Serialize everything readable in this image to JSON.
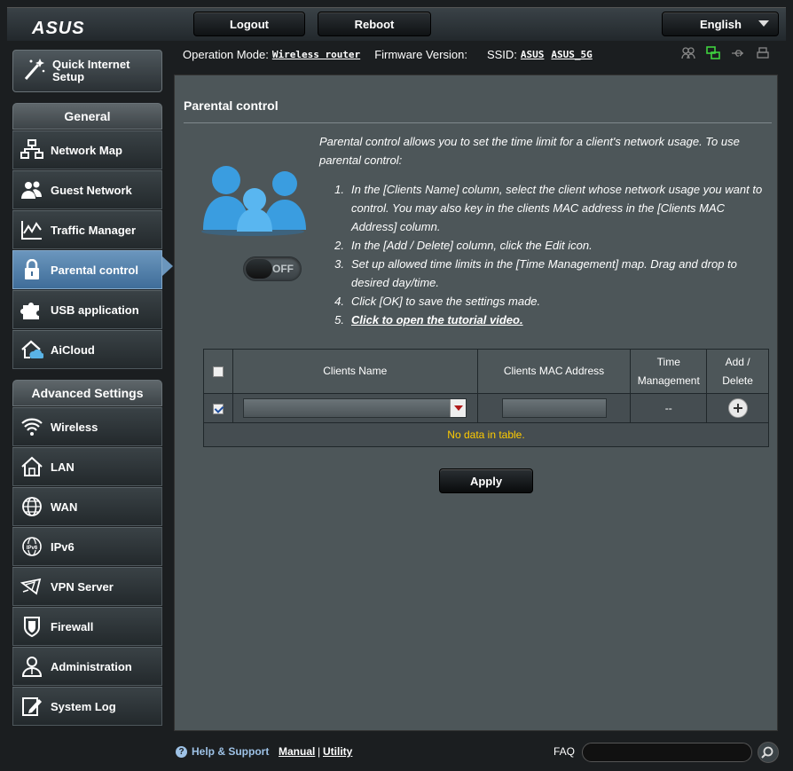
{
  "header": {
    "logo": "ASUS",
    "logout_label": "Logout",
    "reboot_label": "Reboot",
    "language": "English"
  },
  "infobar": {
    "operation_mode_label": "Operation Mode:",
    "operation_mode_value": "Wireless router",
    "firmware_label": "Firmware Version:",
    "ssid_label": "SSID:",
    "ssid_1": "ASUS",
    "ssid_2": "ASUS_5G",
    "status_icons": [
      "clients-icon",
      "network-icon",
      "usb-icon",
      "printer-icon"
    ]
  },
  "sidebar": {
    "qis_label_line1": "Quick Internet",
    "qis_label_line2": "Setup",
    "general_heading": "General",
    "general_items": [
      {
        "label": "Network Map",
        "icon": "network-map-icon"
      },
      {
        "label": "Guest Network",
        "icon": "guest-network-icon"
      },
      {
        "label": "Traffic Manager",
        "icon": "traffic-manager-icon"
      },
      {
        "label": "Parental control",
        "icon": "parental-control-icon",
        "active": true
      },
      {
        "label": "USB application",
        "icon": "usb-application-icon"
      },
      {
        "label": "AiCloud",
        "icon": "aicloud-icon"
      }
    ],
    "advanced_heading": "Advanced Settings",
    "advanced_items": [
      {
        "label": "Wireless",
        "icon": "wireless-icon"
      },
      {
        "label": "LAN",
        "icon": "lan-icon"
      },
      {
        "label": "WAN",
        "icon": "wan-icon"
      },
      {
        "label": "IPv6",
        "icon": "ipv6-icon"
      },
      {
        "label": "VPN Server",
        "icon": "vpn-server-icon"
      },
      {
        "label": "Firewall",
        "icon": "firewall-icon"
      },
      {
        "label": "Administration",
        "icon": "administration-icon"
      },
      {
        "label": "System Log",
        "icon": "system-log-icon"
      }
    ]
  },
  "main": {
    "title": "Parental control",
    "intro": "Parental control allows you to set the time limit for a client's network usage. To use parental control:",
    "toggle_state": "OFF",
    "steps": [
      {
        "num": "1.",
        "text": "In the [Clients Name] column, select the client whose network usage you want to control. You may also key in the clients MAC address in the [Clients MAC Address] column."
      },
      {
        "num": "2.",
        "text": "In the [Add / Delete] column, click the Edit icon."
      },
      {
        "num": "3.",
        "text": "Set up allowed time limits in the [Time Management] map. Drag and drop to desired day/time."
      },
      {
        "num": "4.",
        "text": "Click [OK] to save the settings made."
      },
      {
        "num": "5.",
        "text": "Click to open the tutorial video."
      }
    ],
    "table": {
      "col_clients_name": "Clients Name",
      "col_mac": "Clients MAC Address",
      "col_time_line1": "Time",
      "col_time_line2": "Management",
      "col_add_line1": "Add /",
      "col_add_line2": "Delete",
      "time_placeholder": "--",
      "no_data": "No data in table."
    },
    "apply_label": "Apply"
  },
  "footer": {
    "help_label": "Help & Support",
    "manual_label": "Manual",
    "separator": "|",
    "utility_label": "Utility",
    "faq_label": "FAQ"
  },
  "colors": {
    "active_menu": "#4f7fad",
    "panel_bg": "#4d5659",
    "no_data": "#ffcc00",
    "help_link": "#9ec2e6"
  }
}
